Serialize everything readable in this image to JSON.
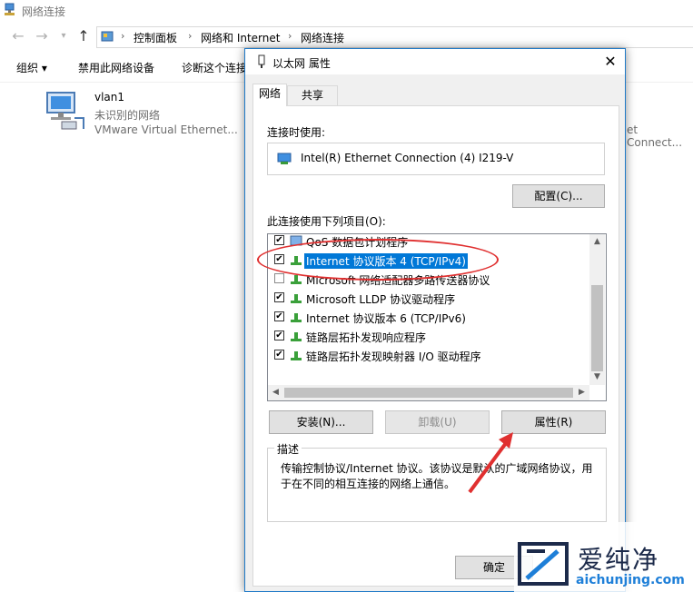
{
  "explorer": {
    "title": "网络连接",
    "breadcrumb": [
      "控制面板",
      "网络和 Internet",
      "网络连接"
    ],
    "commands": [
      "组织 ▾",
      "禁用此网络设备",
      "诊断这个连接"
    ],
    "item": {
      "name": "vlan1",
      "status": "未识别的网络",
      "device": "VMware Virtual Ethernet..."
    },
    "right_item_device": "et Connect..."
  },
  "dialog": {
    "title": "以太网 属性",
    "close_glyph": "✕",
    "tabs": [
      "网络",
      "共享"
    ],
    "connect_using_label": "连接时使用:",
    "adapter_name": "Intel(R) Ethernet Connection (4) I219-V",
    "configure_button": "配置(C)...",
    "items_label": "此连接使用下列项目(O):",
    "items": [
      {
        "label": "QoS 数据包计划程序",
        "checked": true
      },
      {
        "label": "Internet 协议版本 4 (TCP/IPv4)",
        "checked": true,
        "selected": true
      },
      {
        "label": "Microsoft 网络适配器多路传送器协议",
        "checked": false
      },
      {
        "label": "Microsoft LLDP 协议驱动程序",
        "checked": true
      },
      {
        "label": "Internet 协议版本 6 (TCP/IPv6)",
        "checked": true
      },
      {
        "label": "链路层拓扑发现响应程序",
        "checked": true
      },
      {
        "label": "链路层拓扑发现映射器 I/O 驱动程序",
        "checked": true
      }
    ],
    "install_button": "安装(N)...",
    "uninstall_button": "卸载(U)",
    "properties_button": "属性(R)",
    "description_label": "描述",
    "description_text": "传输控制协议/Internet 协议。该协议是默认的广域网络协议，用于在不同的相互连接的网络上通信。",
    "ok_button": "确定"
  },
  "watermark": {
    "brand": "爱纯净",
    "url": "aichunjing.com"
  },
  "colors": {
    "accent": "#0078d7",
    "annotation": "#e03030"
  }
}
